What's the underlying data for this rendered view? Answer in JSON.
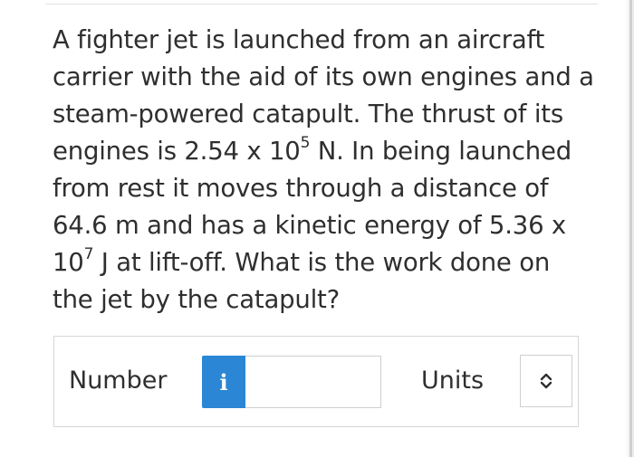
{
  "question": {
    "text_part1": "A fighter jet is launched from an aircraft carrier with the aid of its own engines and a steam-powered catapult. The thrust of its engines is 2.54 x 10",
    "exp1": "5",
    "text_part2": " N. In being launched from rest it moves through a distance of 64.6 m and has a kinetic energy of 5.36 x 10",
    "exp2": "7",
    "text_part3": " J at lift-off. What is the work done on the jet by the catapult?"
  },
  "answer": {
    "number_label": "Number",
    "info_button_label": "i",
    "number_value": "",
    "units_label": "Units",
    "units_selected": ""
  },
  "icons": {
    "info": "info-icon",
    "units_dropdown": "chevron-up-down-icon"
  },
  "colors": {
    "info_button": "#2b87d6",
    "text": "#2f2f2f",
    "border": "#d6d6d6"
  }
}
